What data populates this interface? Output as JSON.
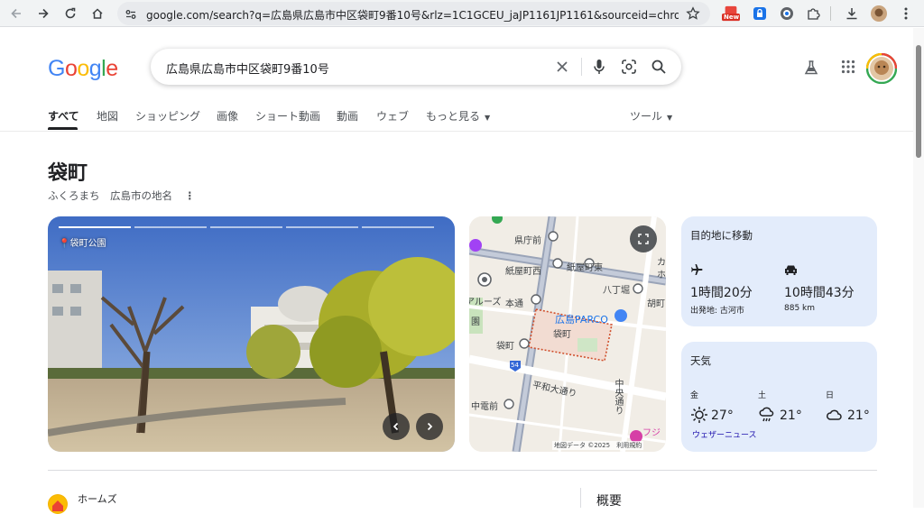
{
  "browser": {
    "url": "google.com/search?q=広島県広島市中区袋町9番10号&rlz=1C1GCEU_jaJP1161JP1161&sourceid=chrome&ie=U...",
    "new_badge": "New"
  },
  "search": {
    "logo": "Google",
    "query": "広島県広島市中区袋町9番10号"
  },
  "tabs": [
    {
      "label": "すべて"
    },
    {
      "label": "地図"
    },
    {
      "label": "ショッピング"
    },
    {
      "label": "画像"
    },
    {
      "label": "ショート動画"
    },
    {
      "label": "動画"
    },
    {
      "label": "ウェブ"
    },
    {
      "label": "もっと見る"
    }
  ],
  "tools_label": "ツール",
  "knowledge_panel": {
    "title": "袋町",
    "subtitle": "ふくろまち　広島市の地名",
    "photo_location": "袋町公園",
    "map": {
      "labels": {
        "kenchomae": "県庁前",
        "kamiyacho_nishi": "紙屋町西",
        "kamiyacho_higashi": "紙屋町東",
        "hatchobori": "八丁堀",
        "hondori": "本通",
        "parco": "広島PARCO",
        "fukuromachi_pin": "袋町",
        "fukuromachi_stop": "袋町",
        "heiwa": "平和大通り",
        "chuo": "中央通り",
        "chuden": "中電前",
        "ebisu": "胡町",
        "route": "54",
        "arus": "アルーズ",
        "ka": "カ",
        "ho": "ホ",
        "en": "園",
        "fuji": "フジ"
      },
      "attribution": "地図データ ©2025",
      "terms": "利用規約"
    }
  },
  "directions": {
    "title": "目的地に移動",
    "flight_time": "1時間20分",
    "origin": "出発地: 古河市",
    "drive_time": "10時間43分",
    "distance": "885 km"
  },
  "weather": {
    "title": "天気",
    "days": [
      {
        "day": "金",
        "temp": "27°",
        "icon": "sun-icon"
      },
      {
        "day": "土",
        "temp": "21°",
        "icon": "rain-icon"
      },
      {
        "day": "日",
        "temp": "21°",
        "icon": "cloud-icon"
      }
    ],
    "source": "ウェザーニュース"
  },
  "below": {
    "source_name": "ホームズ",
    "overview": "概要"
  }
}
